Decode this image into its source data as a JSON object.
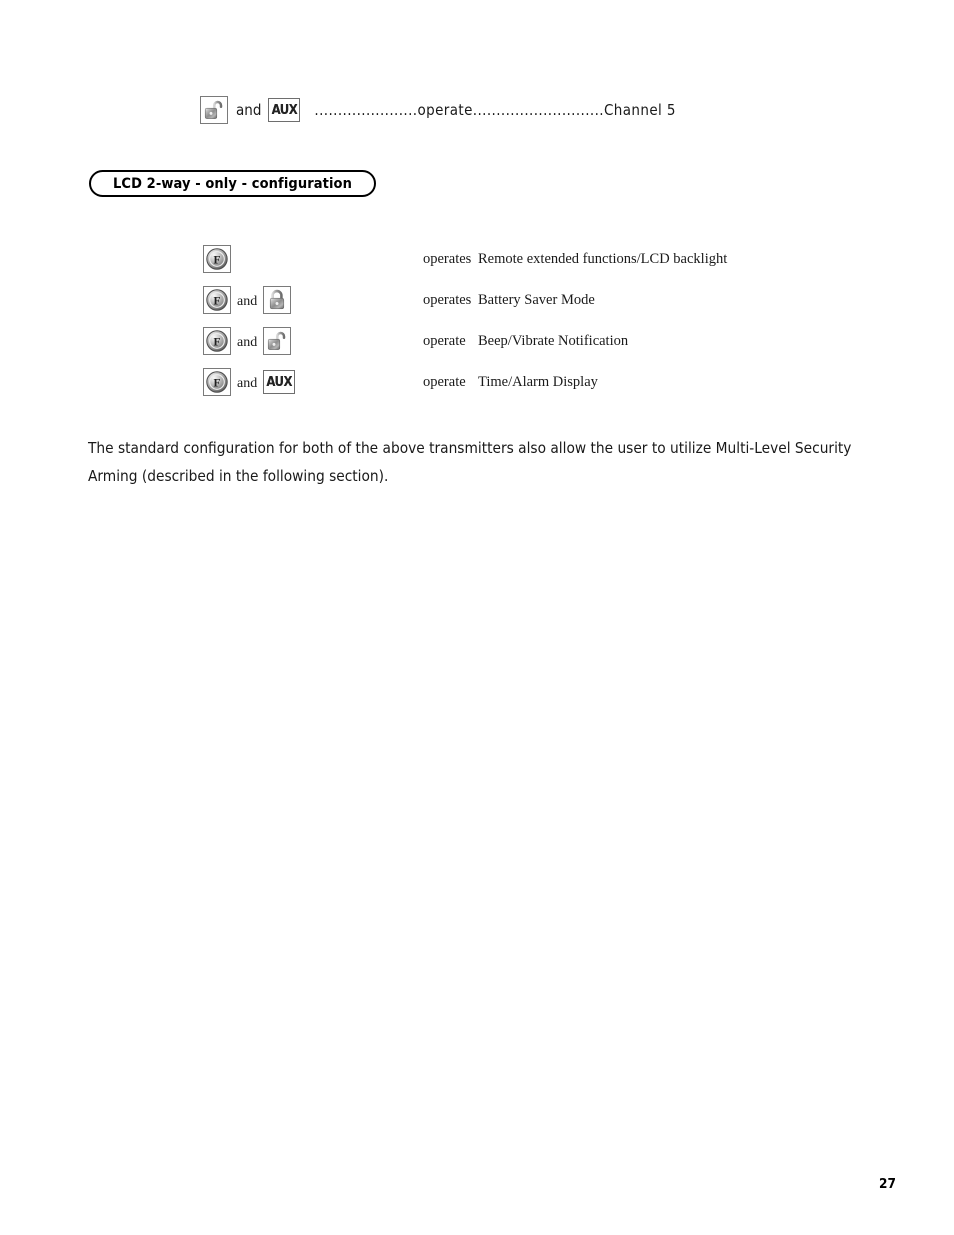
{
  "top_line": {
    "icon1": "unlocked-padlock-icon",
    "and_label": "and",
    "icon2_label": "AUX",
    "leader_text": "......................operate............................Channel 5"
  },
  "section": {
    "pill_label": "LCD 2-way - only - configuration"
  },
  "combinations": [
    {
      "icons": [
        "function-f-icon"
      ],
      "and_label": "",
      "verb": "operates",
      "description": "Remote extended functions/LCD backlight"
    },
    {
      "icons": [
        "function-f-icon",
        "locked-padlock-icon"
      ],
      "and_label": "and",
      "verb": "operates",
      "description": "Battery Saver Mode"
    },
    {
      "icons": [
        "function-f-icon",
        "unlocked-padlock-icon"
      ],
      "and_label": "and",
      "verb": "operate",
      "description": "Beep/Vibrate Notification"
    },
    {
      "icons": [
        "function-f-icon",
        "aux-icon"
      ],
      "and_label": "and",
      "verb": "operate",
      "aux_label": "AUX",
      "description": "Time/Alarm Display"
    }
  ],
  "closing_paragraph": "The standard configuration for both of the above transmitters also allow the user to utilize Multi-Level Security Arming (described in the following section).",
  "page_number": "27",
  "colors": {
    "text": "#1a1a1a",
    "rule": "#000000",
    "icon_border": "#7a7a7a",
    "metal_light": "#e9e9e9",
    "metal_dark": "#6a6a6a"
  }
}
